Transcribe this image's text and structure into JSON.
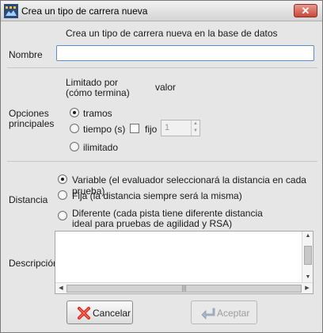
{
  "window": {
    "title": "Crea un tipo de carrera nueva",
    "close_symbol": "✕"
  },
  "header": {
    "text": "Crea un tipo de carrera nueva en la base de datos"
  },
  "name_field": {
    "label": "Nombre",
    "value": ""
  },
  "options": {
    "section_label_line1": "Opciones",
    "section_label_line2": "principales",
    "limit_header_line1": "Limitado por",
    "limit_header_line2": "(cómo termina)",
    "value_header": "valor",
    "radio_tramos": "tramos",
    "radio_tiempo": "tiempo (s)",
    "checkbox_fijo": "fijo",
    "spin_value": "1",
    "radio_ilimitado": "ilimitado",
    "selected": "tramos"
  },
  "distance": {
    "label": "Distancia",
    "variable": "Variable (el evaluador seleccionará la distancia en cada prueba)",
    "fija": "Fija (la distancia siempre será la misma)",
    "diferente_line1": "Diferente (cada pista tiene diferente distancia",
    "diferente_line2": "ideal para pruebas de agilidad y RSA)",
    "selected": "variable"
  },
  "description": {
    "label": "Descripción",
    "value": ""
  },
  "buttons": {
    "cancel": "Cancelar",
    "accept": "Aceptar"
  },
  "icons": [
    "app-icon",
    "close-icon",
    "cancel-icon",
    "accept-icon"
  ],
  "colors": {
    "close_button": "#c9473a",
    "input_focus_border": "#5b8ec8",
    "cancel_icon": "#d2261c",
    "accept_icon_disabled": "#a9b7c9"
  }
}
